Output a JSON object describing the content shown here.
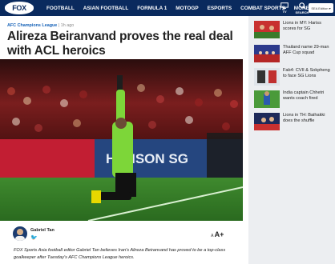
{
  "header": {
    "logo_text": "FOX",
    "nav": [
      "FOOTBALL",
      "ASIAN FOOTBALL",
      "FORMULA 1",
      "MOTOGP",
      "ESPORTS",
      "COMBAT SPORTS",
      "MORE"
    ],
    "tv_label": "TV",
    "search_label": "SEARCH",
    "edition_label": "SEA Edition"
  },
  "article": {
    "category": "AFC Champions League",
    "time": "| 1h ago",
    "headline": "Alireza Beiranvand proves the real deal with ACL heroics",
    "author": "Gabriel Tan",
    "twitter_glyph": "🐦",
    "font_small": "A",
    "font_large": "A+",
    "lede": "FOX Sports Asia football editor Gabriel Tan believes Iran's Alireza Beiranvand has proved to be a top-class goalkeeper after Tuesday's AFC Champions League heroics.",
    "photo_banner_text": "HANSON SG"
  },
  "sidebar": {
    "stories": [
      {
        "title": "Lions in MY: Hariss scores for SG"
      },
      {
        "title": "Thailand name 29-man AFF Cup squad"
      },
      {
        "title": "Fab4: CVII & Sokpheng to face SG Lions"
      },
      {
        "title": "India captain Chhetri wants coach fired"
      },
      {
        "title": "Lions in TH: Baihakki does the shuffle"
      }
    ]
  },
  "colors": {
    "nav_bg": "#0a2a5e",
    "accent": "#1763b8",
    "sidebar_bg": "#eceef1"
  }
}
